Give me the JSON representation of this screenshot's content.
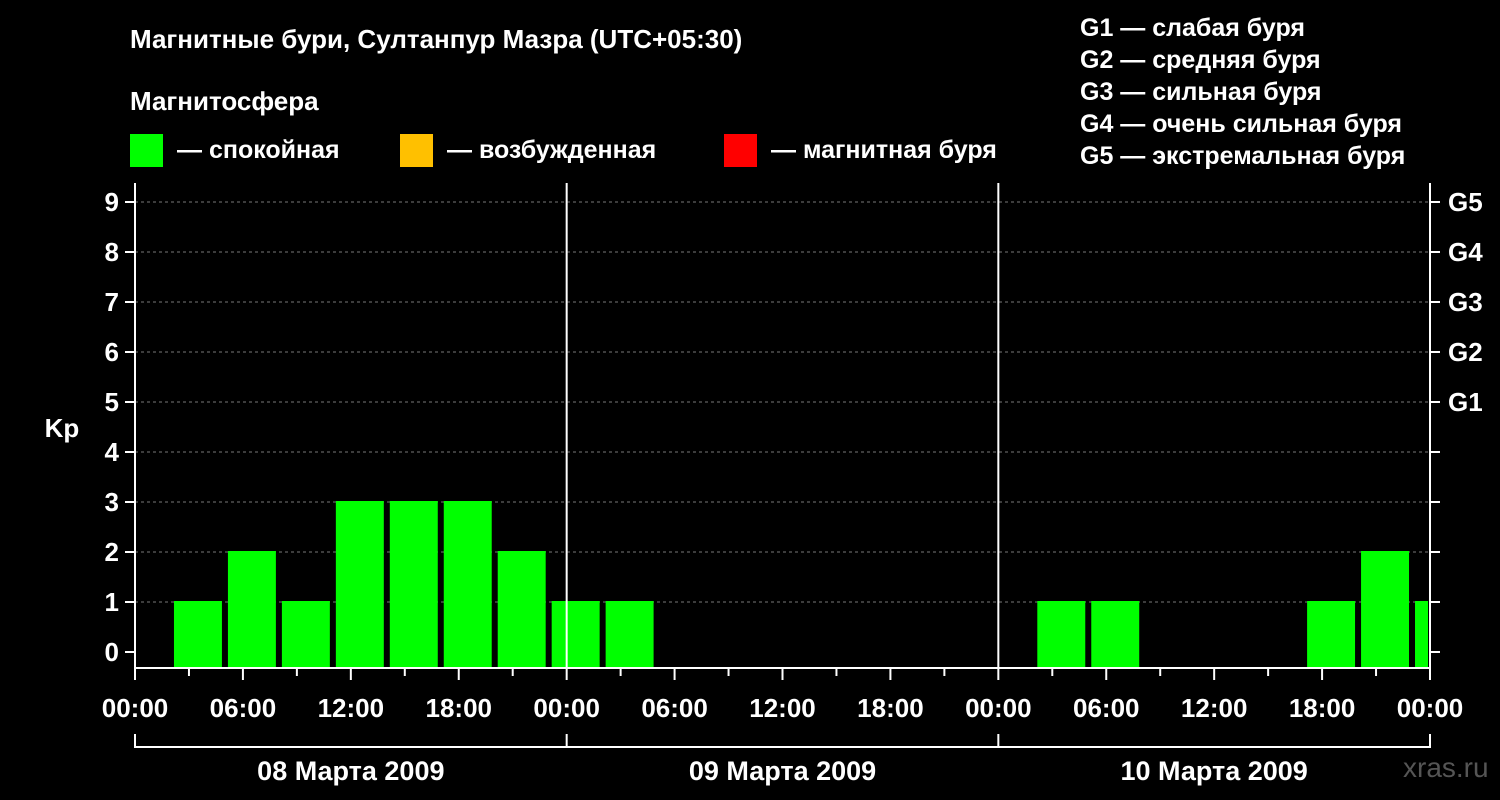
{
  "title": "Магнитные бури, Султанпур Мазра (UTC+05:30)",
  "subtitle": "Магнитосфера",
  "legend": [
    {
      "label": "— спокойная",
      "color": "#00ff00"
    },
    {
      "label": "— возбужденная",
      "color": "#ffc000"
    },
    {
      "label": "— магнитная буря",
      "color": "#ff0000"
    }
  ],
  "g_scale": [
    "G1 — слабая буря",
    "G2 — средняя буря",
    "G3 — сильная буря",
    "G4 — очень сильная буря",
    "G5 — экстремальная буря"
  ],
  "watermark": "xras.ru",
  "chart_data": {
    "type": "bar",
    "ylabel": "Kp",
    "ylim": [
      0,
      9
    ],
    "yticks": [
      0,
      1,
      2,
      3,
      4,
      5,
      6,
      7,
      8,
      9
    ],
    "right_ticks": [
      {
        "value": 5,
        "label": "G1"
      },
      {
        "value": 6,
        "label": "G2"
      },
      {
        "value": 7,
        "label": "G3"
      },
      {
        "value": 8,
        "label": "G4"
      },
      {
        "value": 9,
        "label": "G5"
      }
    ],
    "x_tick_labels": [
      "00:00",
      "06:00",
      "12:00",
      "18:00",
      "00:00",
      "06:00",
      "12:00",
      "18:00",
      "00:00",
      "06:00",
      "12:00",
      "18:00",
      "00:00"
    ],
    "days": [
      "08 Марта 2009",
      "09 Марта 2009",
      "10 Марта 2009"
    ],
    "bar_color": "#00ff00",
    "values": [
      {
        "day": 0,
        "start_hour": 3.5,
        "kp": 1
      },
      {
        "day": 0,
        "start_hour": 6.5,
        "kp": 2
      },
      {
        "day": 0,
        "start_hour": 9.5,
        "kp": 1
      },
      {
        "day": 0,
        "start_hour": 12.5,
        "kp": 3
      },
      {
        "day": 0,
        "start_hour": 15.5,
        "kp": 3
      },
      {
        "day": 0,
        "start_hour": 18.5,
        "kp": 3
      },
      {
        "day": 0,
        "start_hour": 21.5,
        "kp": 2
      },
      {
        "day": 1,
        "start_hour": 0.5,
        "kp": 1
      },
      {
        "day": 1,
        "start_hour": 3.5,
        "kp": 1
      },
      {
        "day": 2,
        "start_hour": 3.5,
        "kp": 1
      },
      {
        "day": 2,
        "start_hour": 6.5,
        "kp": 1
      },
      {
        "day": 2,
        "start_hour": 18.5,
        "kp": 1
      },
      {
        "day": 2,
        "start_hour": 21.5,
        "kp": 2
      },
      {
        "day": 3,
        "start_hour": 0.5,
        "kp": 1
      }
    ]
  }
}
